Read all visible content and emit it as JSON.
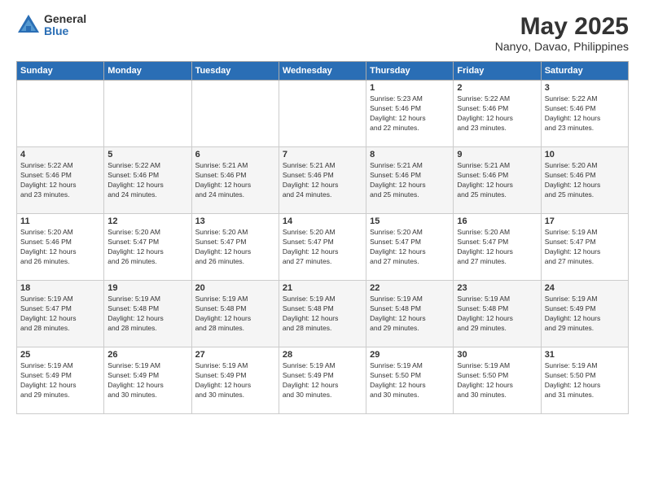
{
  "logo": {
    "general": "General",
    "blue": "Blue"
  },
  "header": {
    "title": "May 2025",
    "subtitle": "Nanyo, Davao, Philippines"
  },
  "days_of_week": [
    "Sunday",
    "Monday",
    "Tuesday",
    "Wednesday",
    "Thursday",
    "Friday",
    "Saturday"
  ],
  "weeks": [
    [
      {
        "day": "",
        "info": ""
      },
      {
        "day": "",
        "info": ""
      },
      {
        "day": "",
        "info": ""
      },
      {
        "day": "",
        "info": ""
      },
      {
        "day": "1",
        "info": "Sunrise: 5:23 AM\nSunset: 5:46 PM\nDaylight: 12 hours\nand 22 minutes."
      },
      {
        "day": "2",
        "info": "Sunrise: 5:22 AM\nSunset: 5:46 PM\nDaylight: 12 hours\nand 23 minutes."
      },
      {
        "day": "3",
        "info": "Sunrise: 5:22 AM\nSunset: 5:46 PM\nDaylight: 12 hours\nand 23 minutes."
      }
    ],
    [
      {
        "day": "4",
        "info": "Sunrise: 5:22 AM\nSunset: 5:46 PM\nDaylight: 12 hours\nand 23 minutes."
      },
      {
        "day": "5",
        "info": "Sunrise: 5:22 AM\nSunset: 5:46 PM\nDaylight: 12 hours\nand 24 minutes."
      },
      {
        "day": "6",
        "info": "Sunrise: 5:21 AM\nSunset: 5:46 PM\nDaylight: 12 hours\nand 24 minutes."
      },
      {
        "day": "7",
        "info": "Sunrise: 5:21 AM\nSunset: 5:46 PM\nDaylight: 12 hours\nand 24 minutes."
      },
      {
        "day": "8",
        "info": "Sunrise: 5:21 AM\nSunset: 5:46 PM\nDaylight: 12 hours\nand 25 minutes."
      },
      {
        "day": "9",
        "info": "Sunrise: 5:21 AM\nSunset: 5:46 PM\nDaylight: 12 hours\nand 25 minutes."
      },
      {
        "day": "10",
        "info": "Sunrise: 5:20 AM\nSunset: 5:46 PM\nDaylight: 12 hours\nand 25 minutes."
      }
    ],
    [
      {
        "day": "11",
        "info": "Sunrise: 5:20 AM\nSunset: 5:46 PM\nDaylight: 12 hours\nand 26 minutes."
      },
      {
        "day": "12",
        "info": "Sunrise: 5:20 AM\nSunset: 5:47 PM\nDaylight: 12 hours\nand 26 minutes."
      },
      {
        "day": "13",
        "info": "Sunrise: 5:20 AM\nSunset: 5:47 PM\nDaylight: 12 hours\nand 26 minutes."
      },
      {
        "day": "14",
        "info": "Sunrise: 5:20 AM\nSunset: 5:47 PM\nDaylight: 12 hours\nand 27 minutes."
      },
      {
        "day": "15",
        "info": "Sunrise: 5:20 AM\nSunset: 5:47 PM\nDaylight: 12 hours\nand 27 minutes."
      },
      {
        "day": "16",
        "info": "Sunrise: 5:20 AM\nSunset: 5:47 PM\nDaylight: 12 hours\nand 27 minutes."
      },
      {
        "day": "17",
        "info": "Sunrise: 5:19 AM\nSunset: 5:47 PM\nDaylight: 12 hours\nand 27 minutes."
      }
    ],
    [
      {
        "day": "18",
        "info": "Sunrise: 5:19 AM\nSunset: 5:47 PM\nDaylight: 12 hours\nand 28 minutes."
      },
      {
        "day": "19",
        "info": "Sunrise: 5:19 AM\nSunset: 5:48 PM\nDaylight: 12 hours\nand 28 minutes."
      },
      {
        "day": "20",
        "info": "Sunrise: 5:19 AM\nSunset: 5:48 PM\nDaylight: 12 hours\nand 28 minutes."
      },
      {
        "day": "21",
        "info": "Sunrise: 5:19 AM\nSunset: 5:48 PM\nDaylight: 12 hours\nand 28 minutes."
      },
      {
        "day": "22",
        "info": "Sunrise: 5:19 AM\nSunset: 5:48 PM\nDaylight: 12 hours\nand 29 minutes."
      },
      {
        "day": "23",
        "info": "Sunrise: 5:19 AM\nSunset: 5:48 PM\nDaylight: 12 hours\nand 29 minutes."
      },
      {
        "day": "24",
        "info": "Sunrise: 5:19 AM\nSunset: 5:49 PM\nDaylight: 12 hours\nand 29 minutes."
      }
    ],
    [
      {
        "day": "25",
        "info": "Sunrise: 5:19 AM\nSunset: 5:49 PM\nDaylight: 12 hours\nand 29 minutes."
      },
      {
        "day": "26",
        "info": "Sunrise: 5:19 AM\nSunset: 5:49 PM\nDaylight: 12 hours\nand 30 minutes."
      },
      {
        "day": "27",
        "info": "Sunrise: 5:19 AM\nSunset: 5:49 PM\nDaylight: 12 hours\nand 30 minutes."
      },
      {
        "day": "28",
        "info": "Sunrise: 5:19 AM\nSunset: 5:49 PM\nDaylight: 12 hours\nand 30 minutes."
      },
      {
        "day": "29",
        "info": "Sunrise: 5:19 AM\nSunset: 5:50 PM\nDaylight: 12 hours\nand 30 minutes."
      },
      {
        "day": "30",
        "info": "Sunrise: 5:19 AM\nSunset: 5:50 PM\nDaylight: 12 hours\nand 30 minutes."
      },
      {
        "day": "31",
        "info": "Sunrise: 5:19 AM\nSunset: 5:50 PM\nDaylight: 12 hours\nand 31 minutes."
      }
    ]
  ]
}
